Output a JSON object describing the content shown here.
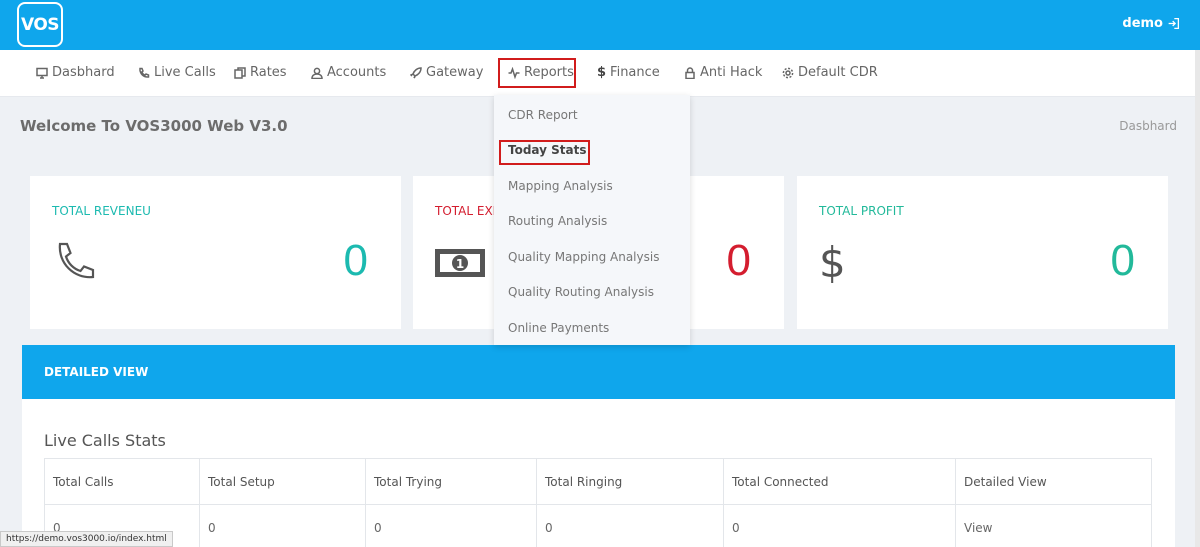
{
  "header": {
    "logo": "VOS",
    "user": "demo"
  },
  "nav": [
    {
      "label": "Dasbhard",
      "icon": "monitor-icon"
    },
    {
      "label": "Live Calls",
      "icon": "phone-icon"
    },
    {
      "label": "Rates",
      "icon": "copy-icon"
    },
    {
      "label": "Accounts",
      "icon": "user-icon"
    },
    {
      "label": "Gateway",
      "icon": "rocket-icon"
    },
    {
      "label": "Reports",
      "icon": "pulse-icon"
    },
    {
      "label": "Finance",
      "icon": "dollar-icon"
    },
    {
      "label": "Anti Hack",
      "icon": "lock-icon"
    },
    {
      "label": "Default CDR",
      "icon": "gear-icon"
    }
  ],
  "reports_menu": [
    "CDR Report",
    "Today Stats",
    "Mapping Analysis",
    "Routing Analysis",
    "Quality Mapping Analysis",
    "Quality Routing Analysis",
    "Online Payments"
  ],
  "page": {
    "title": "Welcome To VOS3000 Web V3.0",
    "breadcrumb": "Dasbhard"
  },
  "cards": [
    {
      "label": "TOTAL REVENEU",
      "value": "0",
      "icon": "phone-icon",
      "color": "#1cbab0"
    },
    {
      "label": "TOTAL EXP",
      "value": "0",
      "icon": "money-icon",
      "color": "#d41d2f"
    },
    {
      "label": "TOTAL PROFIT",
      "value": "0",
      "icon": "dollar-icon",
      "color": "#22b99a"
    }
  ],
  "detail": {
    "header": "DETAILED VIEW",
    "title": "Live Calls Stats",
    "columns": [
      "Total Calls",
      "Total Setup",
      "Total Trying",
      "Total Ringing",
      "Total Connected",
      "Detailed View"
    ],
    "row": [
      "0",
      "0",
      "0",
      "0",
      "0",
      "View"
    ]
  },
  "status_url": "https://demo.vos3000.io/index.html"
}
